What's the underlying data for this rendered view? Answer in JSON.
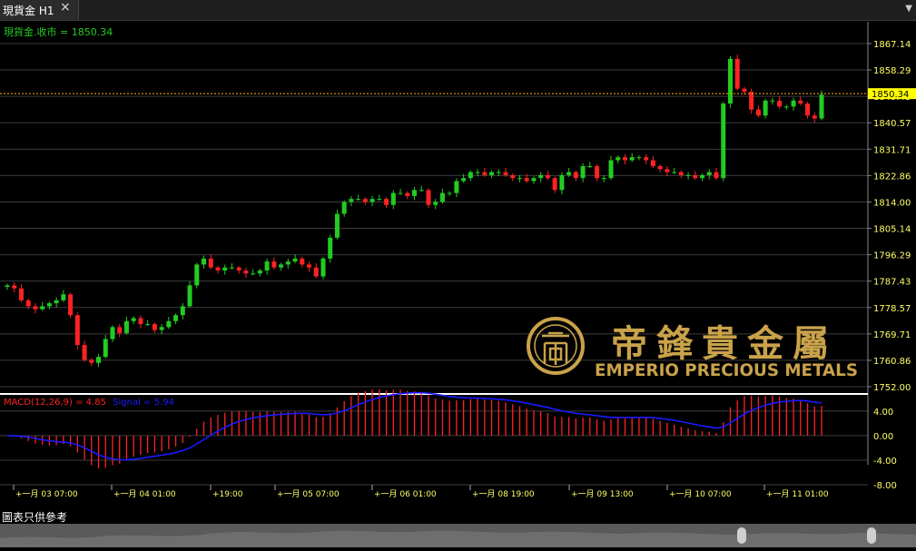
{
  "tab": {
    "title": "現貨金 H1",
    "close_icon": "×",
    "menu_icon": "▼"
  },
  "brand": {
    "chinese_name": "帝鋒貴金屬",
    "english_name": "EMPERIO PRECIOUS METALS",
    "gold": "#c9a24a"
  },
  "footer": {
    "disclaimer": "圖表只供參考"
  },
  "colors": {
    "up": "#22cc22",
    "down": "#ff2222",
    "grid": "#3c3c3c",
    "axis_text": "#ffff66",
    "macd_line": "#1a1aff",
    "bg": "#000000"
  },
  "chart_data": [
    {
      "type": "candlestick",
      "title": "現貨金.收市 = 1850.34",
      "symbol": "現貨金",
      "timeframe": "H1",
      "last_price": 1850.34,
      "ylim": [
        1752.0,
        1867.14
      ],
      "y_ticks": [
        "1867.14",
        "1858.29",
        "1849.43",
        "1840.57",
        "1831.71",
        "1822.86",
        "1814.00",
        "1805.14",
        "1796.29",
        "1787.43",
        "1778.57",
        "1769.71",
        "1760.86",
        "1752.00"
      ],
      "x_ticks": [
        "一月 03 07:00",
        "一月 04 01:00",
        "19:00",
        "一月 05 07:00",
        "一月 06 01:00",
        "一月 08 19:00",
        "一月 09 13:00",
        "一月 10 07:00",
        "一月 11 01:00"
      ],
      "grid": true,
      "closes": [
        1786,
        1785,
        1781,
        1779,
        1778,
        1779,
        1780,
        1781,
        1783,
        1776,
        1766,
        1761,
        1760,
        1762,
        1768,
        1772,
        1770,
        1774,
        1775,
        1773,
        1773,
        1771,
        1772,
        1774,
        1776,
        1779,
        1786,
        1793,
        1795,
        1792,
        1791,
        1792,
        1792,
        1791,
        1790,
        1790,
        1791,
        1794,
        1792,
        1793,
        1794,
        1795,
        1793,
        1792,
        1789,
        1795,
        1802,
        1810,
        1814,
        1815,
        1815,
        1814,
        1815,
        1815,
        1813,
        1817,
        1817,
        1816,
        1818,
        1818,
        1813,
        1814,
        1817,
        1817,
        1821,
        1822,
        1824,
        1824,
        1823,
        1824,
        1824,
        1823,
        1822,
        1822,
        1821,
        1822,
        1823,
        1822,
        1818,
        1823,
        1824,
        1822,
        1826,
        1826,
        1822,
        1822,
        1828,
        1829,
        1828,
        1829,
        1829,
        1828,
        1826,
        1825,
        1824,
        1824,
        1823,
        1823,
        1822,
        1823,
        1824,
        1822,
        1847,
        1862,
        1852,
        1851,
        1845,
        1843,
        1848,
        1848,
        1846,
        1846,
        1848,
        1847,
        1843,
        1842,
        1850
      ]
    },
    {
      "type": "bar",
      "title": "MACD(12,26,9) = 4.85",
      "signal_label": "Signal = 5.94",
      "macd_last": 4.85,
      "signal_last": 5.94,
      "ylim": [
        -8.0,
        6.5
      ],
      "y_ticks": [
        "4.00",
        "0.00",
        "-4.00",
        "-8.00"
      ],
      "grid": true
    }
  ]
}
